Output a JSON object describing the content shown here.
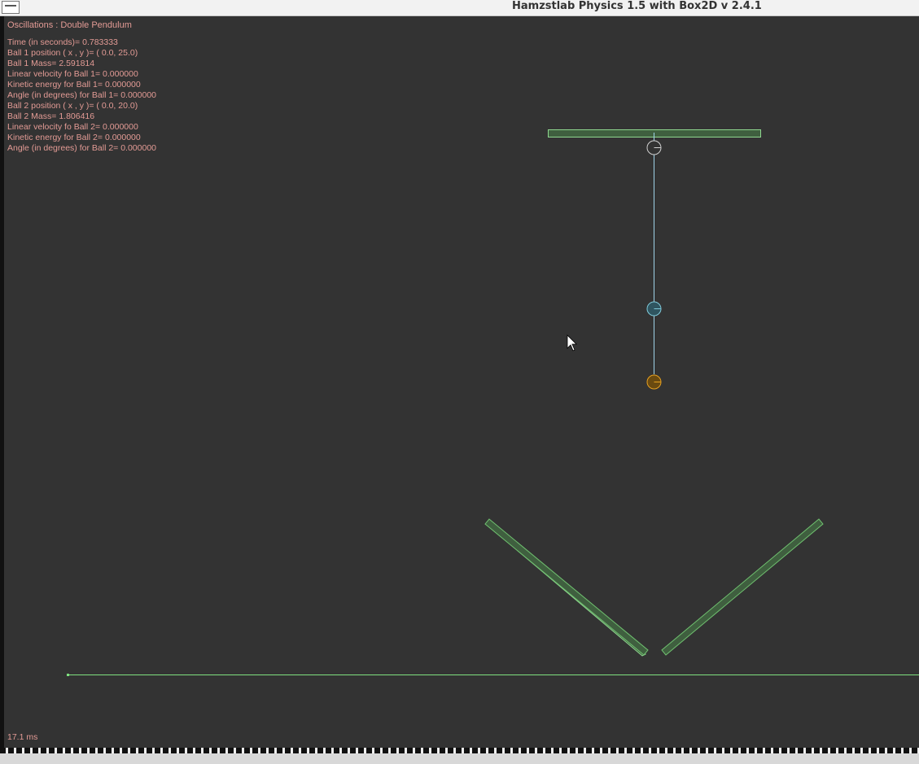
{
  "window": {
    "title": "Hamzstlab Physics 1.5 with Box2D v 2.4.1"
  },
  "hud": {
    "scene_title": "Oscillations : Double Pendulum",
    "stats": [
      "Time (in seconds)= 0.783333",
      "Ball 1 position ( x , y )= ( 0.0, 25.0)",
      "Ball 1 Mass= 2.591814",
      "Linear velocity fo Ball 1= 0.000000",
      "Kinetic energy for Ball 1= 0.000000",
      "Angle (in degrees) for Ball 1= 0.000000",
      "Ball 2 position ( x , y )= ( 0.0, 20.0)",
      "Ball 2 Mass= 1.806416",
      "Linear velocity fo Ball 2= 0.000000",
      "Kinetic energy for Ball 2= 0.000000",
      "Angle (in degrees) for Ball 2= 0.000000"
    ],
    "frame_time": "17.1 ms"
  },
  "colors": {
    "background": "#333333",
    "hud_text": "#e39b95",
    "static_body_fill": "#3f5f3f",
    "static_body_outline": "#8fd68f",
    "ground_line": "#7fe07f",
    "pendulum_rod": "#9fd3e8",
    "anchor_ball": "#d0d0d0",
    "ball_1": "#7ec8d8",
    "ball_2": "#e6a020"
  }
}
